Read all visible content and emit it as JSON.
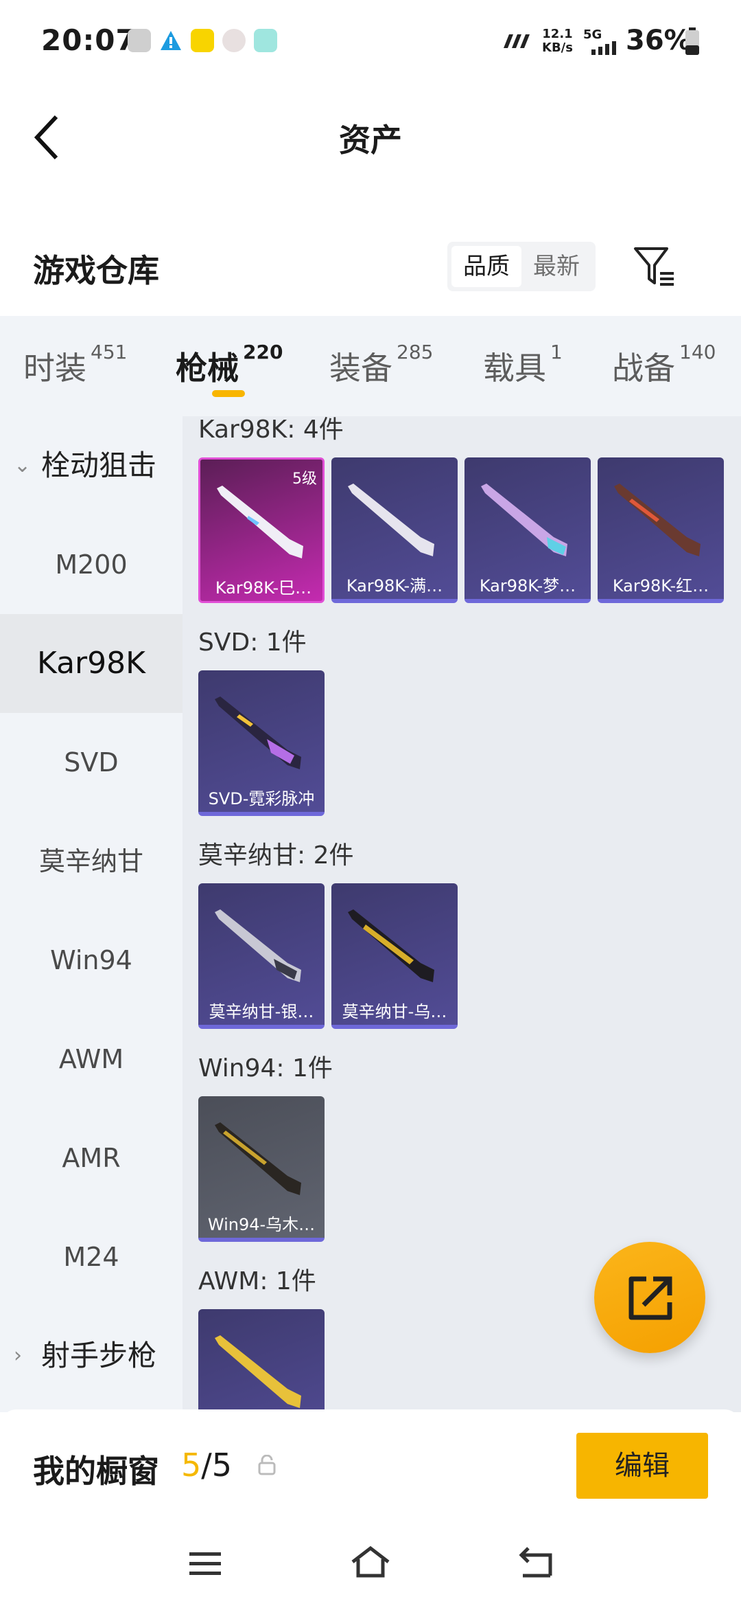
{
  "status_bar": {
    "time": "20:07",
    "net_speed_value": "12.1",
    "net_speed_unit": "KB/s",
    "signal": "5G",
    "battery": "36%"
  },
  "header": {
    "title": "资产"
  },
  "warehouse": {
    "title": "游戏仓库",
    "sort_quality": "品质",
    "sort_newest": "最新"
  },
  "tabs": [
    {
      "label": "时装",
      "count": "451"
    },
    {
      "label": "枪械",
      "count": "220"
    },
    {
      "label": "装备",
      "count": "285"
    },
    {
      "label": "载具",
      "count": "1"
    },
    {
      "label": "战备",
      "count": "140"
    }
  ],
  "sidebar": {
    "group_open": "栓动狙击",
    "items": [
      "M200",
      "Kar98K",
      "SVD",
      "莫辛纳甘",
      "Win94",
      "AWM",
      "AMR",
      "M24"
    ],
    "group_closed": "射手步枪"
  },
  "sections": [
    {
      "title": "Kar98K: 4件",
      "items": [
        {
          "name": "Kar98K-巳…",
          "level": "5级"
        },
        {
          "name": "Kar98K-满…"
        },
        {
          "name": "Kar98K-梦…"
        },
        {
          "name": "Kar98K-红…"
        }
      ]
    },
    {
      "title": "SVD: 1件",
      "items": [
        {
          "name": "SVD-霓彩脉冲"
        }
      ]
    },
    {
      "title": "莫辛纳甘: 2件",
      "items": [
        {
          "name": "莫辛纳甘-银…"
        },
        {
          "name": "莫辛纳甘-乌…"
        }
      ]
    },
    {
      "title": "Win94: 1件",
      "items": [
        {
          "name": "Win94-乌木…"
        }
      ]
    },
    {
      "title": "AWM: 1件",
      "items": [
        {
          "name": ""
        }
      ]
    }
  ],
  "showcase": {
    "label": "我的橱窗",
    "current": "5",
    "separator": "/",
    "total": "5",
    "edit_label": "编辑"
  },
  "colors": {
    "accent": "#f7b500",
    "tab_underline": "#f8b500",
    "rarity_purple": "#6e68d9",
    "rarity_pink": "#e14fd6"
  }
}
